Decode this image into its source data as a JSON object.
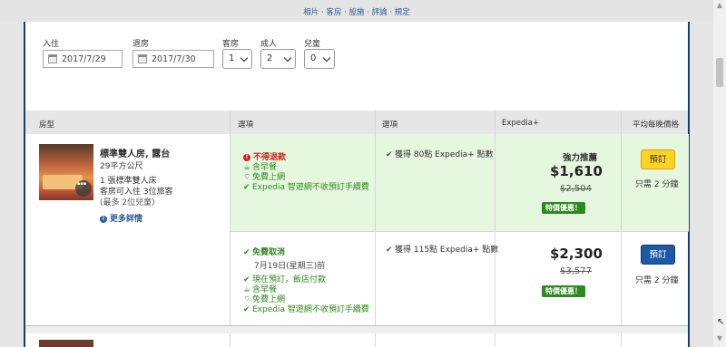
{
  "top_nav": "相片 · 客房 · 設施 · 評論 · 規定",
  "search": {
    "checkin_label": "入住",
    "checkin_value": "2017/7/29",
    "checkout_label": "退房",
    "checkout_value": "2017/7/30",
    "rooms_label": "客房",
    "rooms_value": "1",
    "adults_label": "成人",
    "adults_value": "2",
    "children_label": "兒童",
    "children_value": "0"
  },
  "table": {
    "headers": [
      "房型",
      "選項",
      "選項",
      "Expedia+",
      "平均每晚價格"
    ]
  },
  "room": {
    "name": "標準雙人房, 露台",
    "size": "29平方公尺",
    "bed": "1 張標準雙人床",
    "capacity": "客房可入住 3位旅客",
    "children_note": "(最多 2位兒童)",
    "more_details": "更多詳情"
  },
  "rates": [
    {
      "options": [
        "不得退款",
        "含早餐",
        "免費上網",
        "Expedia 智遊網不收預訂手續費"
      ],
      "points": "獲得 80點 Expedia+ 點數",
      "recommend": "強力推薦",
      "price": "$1,610",
      "orig_price": "$2,504",
      "deal": "特價優惠！",
      "book": "預訂",
      "urgency": "只需 2 分鐘"
    },
    {
      "options": [
        "免費取消",
        "7月19日(星期三)前",
        "現在預訂，飯店付款",
        "含早餐",
        "免費上網",
        "Expedia 智遊網不收預訂手續費"
      ],
      "points": "獲得 115點 Expedia+ 點數",
      "price": "$2,300",
      "orig_price": "$3,577",
      "deal": "特價優惠！",
      "book": "預訂",
      "urgency": "只需 2 分鐘"
    }
  ]
}
